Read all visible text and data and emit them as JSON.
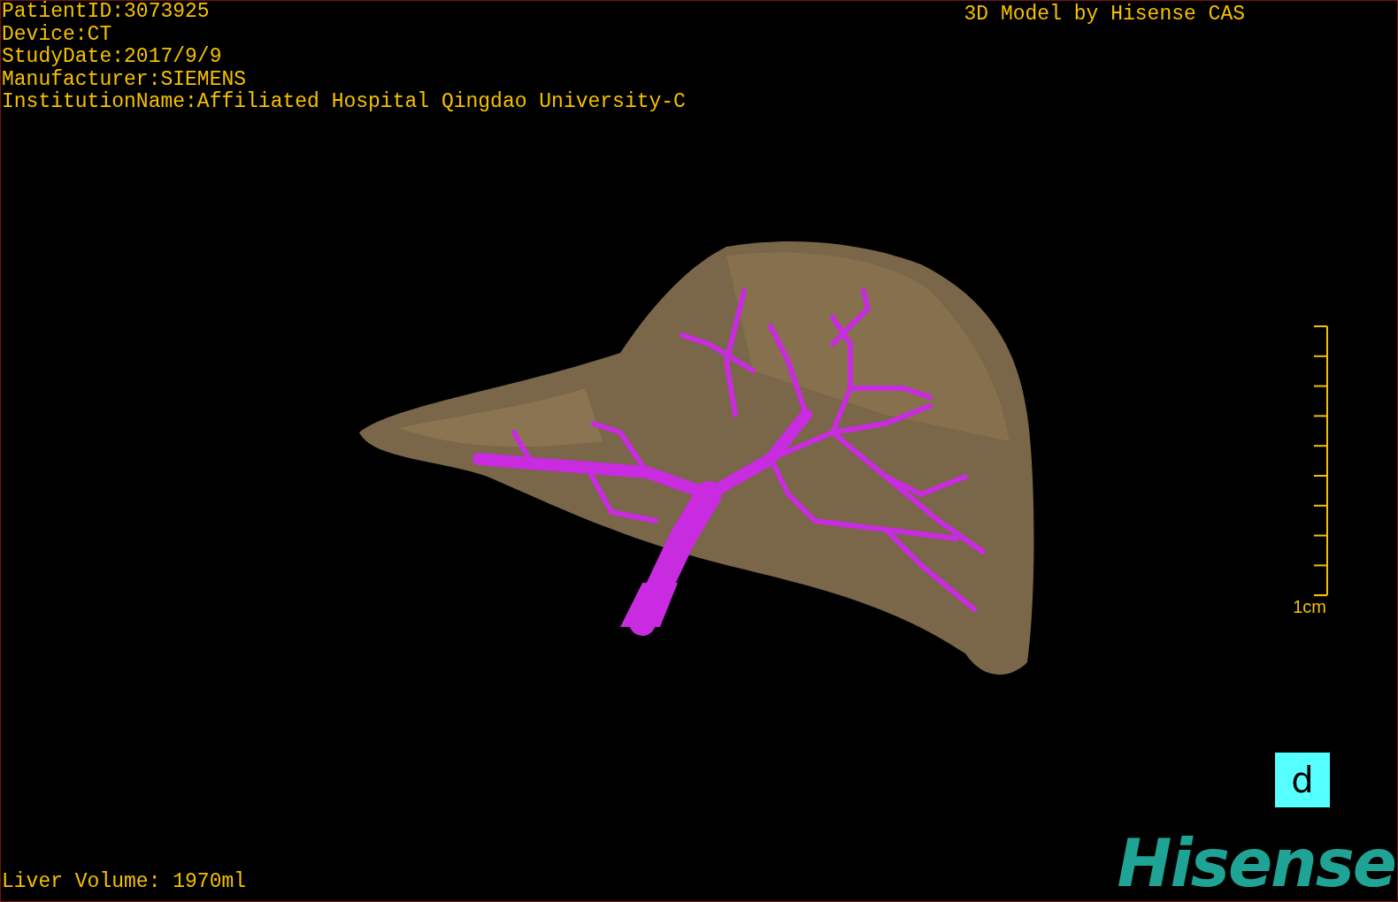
{
  "info_lines": [
    "PatientID:3073925",
    "Device:CT",
    "StudyDate:2017/9/9",
    "Manufacturer:SIEMENS",
    "InstitutionName:Affiliated Hospital Qingdao University-C"
  ],
  "title": "3D Model by Hisense CAS",
  "scale_label": "1cm",
  "orientation_marker": "d",
  "logo": "Hisense",
  "liver_volume": "Liver Volume: 1970ml"
}
